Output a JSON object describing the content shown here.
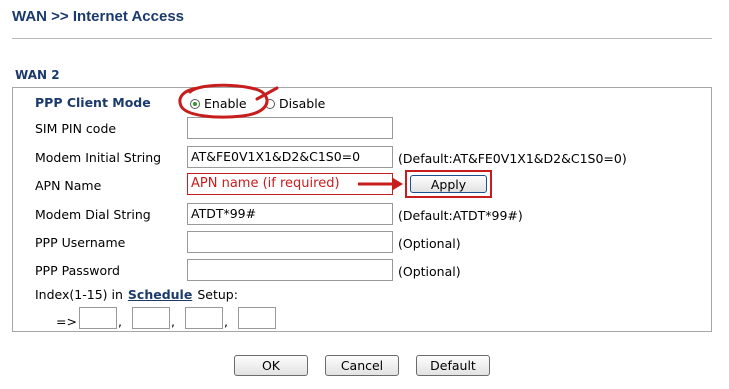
{
  "header": {
    "title": "WAN >> Internet Access"
  },
  "section": {
    "title": "WAN 2"
  },
  "form": {
    "ppp_client_mode": {
      "label": "PPP Client Mode",
      "options": [
        "Enable",
        "Disable"
      ],
      "selected": "Enable"
    },
    "sim_pin": {
      "label": "SIM PIN code",
      "value": ""
    },
    "modem_init": {
      "label": "Modem Initial String",
      "value": "AT&FE0V1X1&D2&C1S0=0",
      "hint": "(Default:AT&FE0V1X1&D2&C1S0=0)"
    },
    "apn": {
      "label": "APN Name",
      "value": "APN name (if required)",
      "apply_label": "Apply"
    },
    "modem_dial": {
      "label": "Modem Dial String",
      "value": "ATDT*99#",
      "hint": "(Default:ATDT*99#)"
    },
    "ppp_username": {
      "label": "PPP Username",
      "value": "",
      "hint": "(Optional)"
    },
    "ppp_password": {
      "label": "PPP Password",
      "value": "",
      "hint": "(Optional)"
    },
    "schedule": {
      "prefix": "Index(1-15) in",
      "link": "Schedule",
      "suffix": "Setup:",
      "arrow": "=>",
      "separator": ",",
      "values": [
        "",
        "",
        "",
        ""
      ]
    }
  },
  "footer": {
    "ok": "OK",
    "cancel": "Cancel",
    "default": "Default"
  },
  "colors": {
    "annotation": "#c81d1d",
    "heading": "#1b3a6b"
  }
}
